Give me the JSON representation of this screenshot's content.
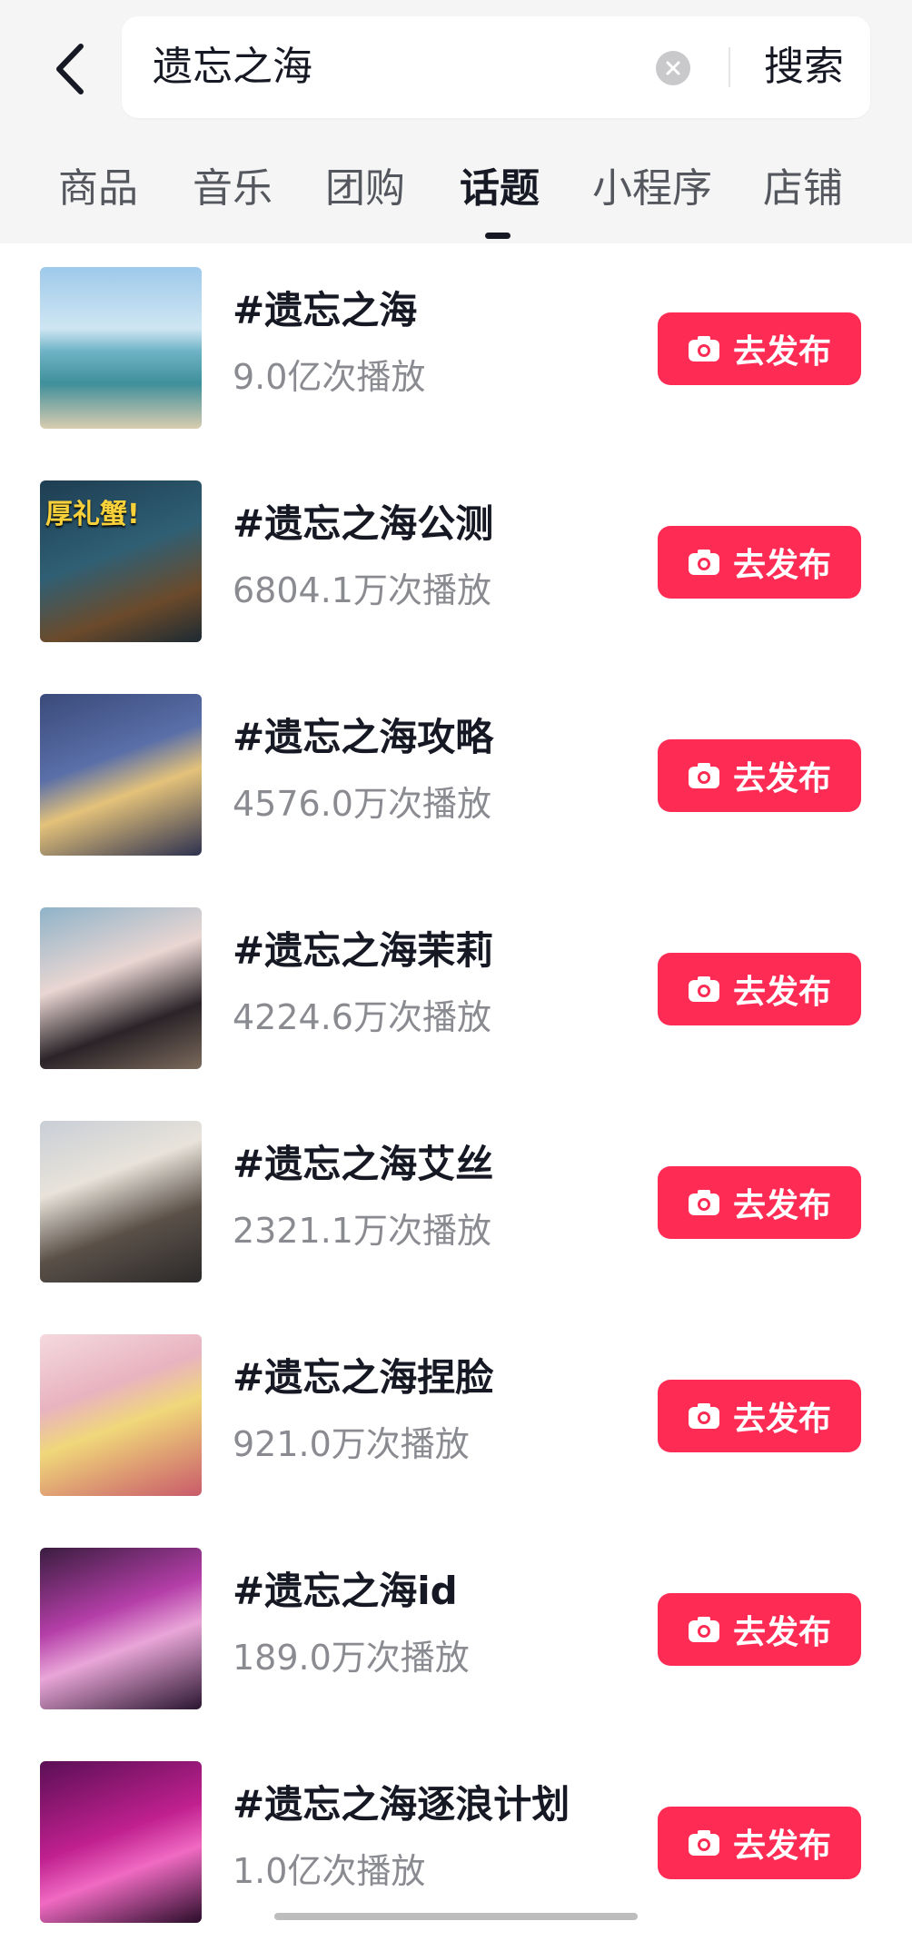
{
  "search": {
    "query": "遗忘之海",
    "button_label": "搜索"
  },
  "tabs": [
    {
      "label": "商品"
    },
    {
      "label": "音乐"
    },
    {
      "label": "团购"
    },
    {
      "label": "话题",
      "active": true
    },
    {
      "label": "小程序"
    },
    {
      "label": "店铺"
    }
  ],
  "topics": [
    {
      "title": "#遗忘之海",
      "views": "9.0亿次播放",
      "action": "去发布"
    },
    {
      "title": "#遗忘之海公测",
      "views": "6804.1万次播放",
      "action": "去发布",
      "thumb_caption": "厚礼蟹!"
    },
    {
      "title": "#遗忘之海攻略",
      "views": "4576.0万次播放",
      "action": "去发布"
    },
    {
      "title": "#遗忘之海茉莉",
      "views": "4224.6万次播放",
      "action": "去发布"
    },
    {
      "title": "#遗忘之海艾丝",
      "views": "2321.1万次播放",
      "action": "去发布"
    },
    {
      "title": "#遗忘之海捏脸",
      "views": "921.0万次播放",
      "action": "去发布"
    },
    {
      "title": "#遗忘之海id",
      "views": "189.0万次播放",
      "action": "去发布"
    },
    {
      "title": "#遗忘之海逐浪计划",
      "views": "1.0亿次播放",
      "action": "去发布"
    }
  ],
  "icons": {
    "back": "chevron-left-icon",
    "clear": "clear-icon",
    "camera": "camera-icon"
  },
  "colors": {
    "accent": "#fe2c55",
    "tab_active": "#161823"
  }
}
